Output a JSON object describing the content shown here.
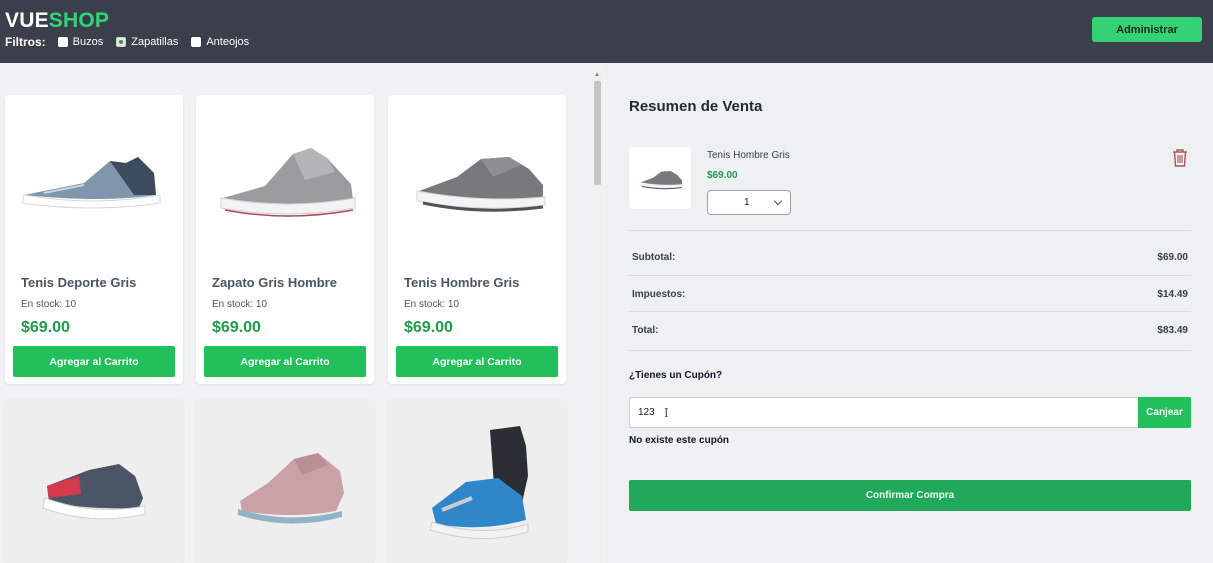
{
  "header": {
    "logo_part1": "VUE",
    "logo_part2": "SHOP",
    "filters_label": "Filtros:",
    "filters": [
      {
        "label": "Buzos",
        "checked": false
      },
      {
        "label": "Zapatillas",
        "checked": true
      },
      {
        "label": "Anteojos",
        "checked": false
      }
    ],
    "admin_label": "Administrar"
  },
  "products": [
    {
      "name": "Tenis Deporte Gris",
      "stock": "En stock: 10",
      "price": "$69.00",
      "button": "Agregar al Carrito"
    },
    {
      "name": "Zapato Gris Hombre",
      "stock": "En stock: 10",
      "price": "$69.00",
      "button": "Agregar al Carrito"
    },
    {
      "name": "Tenis Hombre Gris",
      "stock": "En stock: 10",
      "price": "$69.00",
      "button": "Agregar al Carrito"
    }
  ],
  "summary": {
    "title": "Resumen de Venta",
    "item": {
      "name": "Tenis Hombre Gris",
      "price": "$69.00",
      "qty": "1"
    },
    "subtotal_label": "Subtotal:",
    "subtotal": "$69.00",
    "tax_label": "Impuestos:",
    "tax": "$14.49",
    "total_label": "Total:",
    "total": "$83.49",
    "coupon_question": "¿Tienes un Cupón?",
    "coupon_value": "123",
    "coupon_button": "Canjear",
    "coupon_error": "No existe este cupón",
    "confirm_button": "Confirmar Compra"
  },
  "colors": {
    "header_bg": "#3a3f4b",
    "accent_green": "#22c05a",
    "price_green": "#1f9d4c",
    "logo_green": "#2fd67a"
  }
}
